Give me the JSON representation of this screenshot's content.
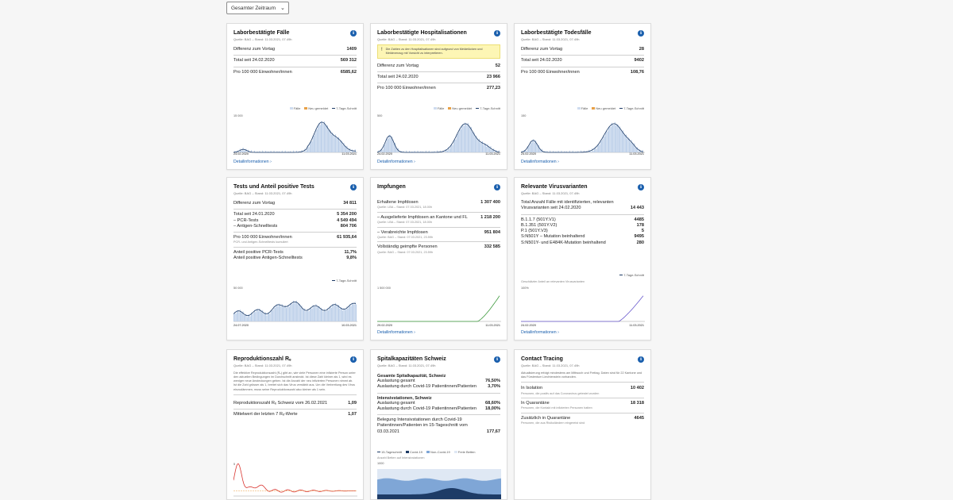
{
  "period_select": "Gesamter Zeitraum",
  "info_glyph": "i",
  "more_link": "Detailinformationen",
  "cards": {
    "faelle": {
      "title": "Laborbestätigte Fälle",
      "source": "Quelle: BAG – Stand: 11.03.2021, 07.49h",
      "rows": [
        {
          "label": "Differenz zum Vortag",
          "value": "1409"
        },
        {
          "label": "Total seit 24.02.2020",
          "value": "569 312"
        },
        {
          "label": "Pro 100 000 Einwohner/innen",
          "value": "6585,62"
        }
      ],
      "legend": [
        "Fälle",
        "Neu gemeldet",
        "7-Tage-Schnitt"
      ],
      "y_top": "15 000",
      "x_start": "24.02.2020",
      "x_end": "11.03.2021"
    },
    "hosp": {
      "title": "Laborbestätigte Hospitalisationen",
      "source": "Quelle: BAG – Stand: 11.03.2021, 07.49h",
      "notice": "Die Zahlen zu den Hospitalisationen sind aufgrund von Meldelücken und Meldeverzug mit Vorsicht zu interpretieren.",
      "rows": [
        {
          "label": "Differenz zum Vortag",
          "value": "52"
        },
        {
          "label": "Total seit 24.02.2020",
          "value": "23 966"
        },
        {
          "label": "Pro 100 000 Einwohner/innen",
          "value": "277,23"
        }
      ],
      "legend": [
        "Fälle",
        "Neu gemeldet",
        "7-Tage-Schnitt"
      ],
      "y_top": "500",
      "x_start": "24.02.2020",
      "x_end": "11.03.2021"
    },
    "tod": {
      "title": "Laborbestätigte Todesfälle",
      "source": "Quelle: BAG – Stand: 11.03.2021, 07.49h",
      "rows": [
        {
          "label": "Differenz zum Vortag",
          "value": "28"
        },
        {
          "label": "Total seit 24.02.2020",
          "value": "9402"
        },
        {
          "label": "Pro 100 000 Einwohner/innen",
          "value": "108,76"
        }
      ],
      "legend": [
        "Fälle",
        "Neu gemeldet",
        "7-Tage-Schnitt"
      ],
      "y_top": "150",
      "x_start": "24.02.2020",
      "x_end": "11.03.2021"
    },
    "tests": {
      "title": "Tests und Anteil positive Tests",
      "source": "Quelle: BAG – Stand: 11.03.2021, 07.49h",
      "diff_label": "Differenz zum Vortag",
      "diff_value": "34 811",
      "total_label": "Total seit 24.01.2020",
      "total_value": "5 354 200",
      "pcr_label": "PCR-Tests",
      "pcr_value": "4 549 494",
      "antigen_label": "Antigen-Schnelltests",
      "antigen_value": "804 706",
      "per100_label": "Pro 100 000 Einwohner/innen",
      "per100_value": "61 935,64",
      "per100_sub": "PCR- und Antigen-Schnelltests kumuliert",
      "pos_pcr_label": "Anteil positive PCR-Tests",
      "pos_pcr_value": "11,7%",
      "pos_ag_label": "Anteil positive Antigen-Schnelltests",
      "pos_ag_value": "9,8%",
      "legend": "7-Tage-Schnitt",
      "y_top": "50 000",
      "x_start": "24.07.2020",
      "x_end": "10.03.2021"
    },
    "impf": {
      "title": "Impfungen",
      "rows": [
        {
          "label": "Erhaltene Impfdosen",
          "sub": "Quelle: LBA – Stand: 07.03.2021, 18.00h",
          "value": "1 307 400"
        },
        {
          "label": "Ausgelieferte Impfdosen an Kantone und FL",
          "sub": "Quelle: LBA – Stand: 07.03.2021, 18.00h",
          "value": "1 218 200"
        },
        {
          "label": "Verabreichte Impfdosen",
          "sub": "Quelle: BAG – Stand: 07.03.2021, 23.59h",
          "value": "951 804"
        },
        {
          "label": "Vollständig geimpfte Personen",
          "sub": "Quelle: BAG – Stand: 07.03.2021, 23.59h",
          "value": "332 585"
        }
      ],
      "y_top": "1 500 000",
      "x_start": "29.02.2020",
      "x_end": "11.03.2021"
    },
    "varianten": {
      "title": "Relevante Virusvarianten",
      "source": "Quelle: BAG – Stand: 11.03.2021, 07.49h",
      "total_label": "Total Anzahl Fälle mit identifizierten, relevanten Virusvarianten seit 24.02.2020",
      "total_value": "14 443",
      "rows": [
        {
          "label": "B.1.1.7 (501Y.V1)",
          "value": "4485"
        },
        {
          "label": "B.1.351 (501Y.V2)",
          "value": "178"
        },
        {
          "label": "P.1 (501Y.V3)",
          "value": "5"
        },
        {
          "label": "S:N501Y – Mutation beinhaltend",
          "value": "9495"
        },
        {
          "label": "S:N501Y- und E484K-Mutation beinhaltend",
          "value": "280"
        }
      ],
      "legend": "7-Tage-Schnitt",
      "chart_caption": "Geschätzter Anteil an relevanten Virusvarianten",
      "y_top": "100%",
      "x_start": "24.02.2020",
      "x_end": "11.03.2021"
    },
    "re": {
      "title": "Reproduktionszahl Rₑ",
      "source": "Quelle: BAG – Stand: 11.03.2021, 07.49h",
      "desc": "Die effektive Reproduktionszahl (Rₑ) gibt an, wie viele Personen eine infizierte Person unter den aktuellen Bedingungen im Durchschnitt ansteckt. Ist diese Zahl kleiner als 1, wird es weniger neue Ansteckungen geben. Ist die Anzahl der neu infizierten Personen nimmt ab. Ist die Zahl grösser als 1, breitet sich das Virus verstärkt aus. Um die Verbreitung des Virus einzudämmen, muss seine Reproduktionszahl also kleiner als 1 sein.",
      "rows": [
        {
          "label": "Reproduktionszahl Rₑ Schweiz vom 26.02.2021",
          "value": "1,09"
        },
        {
          "label": "Mittelwert der letzten 7 Rₑ-Werte",
          "value": "1,07"
        }
      ],
      "y_top": "5"
    },
    "spital": {
      "title": "Spitalkapazitäten Schweiz",
      "source": "Quelle: BAG – Stand: 11.03.2021, 07.49h",
      "section1": "Gesamte Spitalkapazität, Schweiz",
      "rows1": [
        {
          "label": "Auslastung gesamt",
          "value": "76,50%"
        },
        {
          "label": "Auslastung durch Covid-19 Patientinnen/Patienten",
          "value": "3,70%"
        }
      ],
      "section2": "Intensivstationen, Schweiz",
      "rows2": [
        {
          "label": "Auslastung gesamt",
          "value": "68,60%"
        },
        {
          "label": "Auslastung durch Covid-19 Patientinnen/Patienten",
          "value": "18,00%"
        }
      ],
      "belegung_label": "Belegung Intensivstationen durch Covid-19 Patientinnen/Patienten im 15-Tageschnitt vom 03.03.2021",
      "belegung_value": "177,67",
      "legend": [
        "15-Tageschnitt",
        "Covid-19",
        "Non-Covid-19",
        "Freie Betten"
      ],
      "chart_caption": "Anzahl Betten auf Intensivstationen",
      "y_top": "1000"
    },
    "contact": {
      "title": "Contact Tracing",
      "source": "Quelle: BAG – Stand: 11.03.2021, 07.49h",
      "desc": "Aktualisierung erfolgt mindestens am Mittwoch und Freitag. Daten sind für 22 Kantone und das Fürstentum Liechtenstein vorhanden.",
      "rows": [
        {
          "label": "In Isolation",
          "sub": "Personen, die positiv auf das Coronavirus getestet wurden",
          "value": "10 402"
        },
        {
          "label": "In Quarantäne",
          "sub": "Personen, die Kontakt mit infizierten Personen hatten",
          "value": "18 318"
        },
        {
          "label": "Zusätzlich in Quarantäne",
          "sub": "Personen, die aus Risikoländern eingereist sind",
          "value": "4645"
        }
      ]
    }
  },
  "colors": {
    "accent": "#1a5fad",
    "bars": "#b9cde8",
    "line": "#1d3b66",
    "orange": "#e8a046",
    "green": "#3d9a3d",
    "red": "#d9332e"
  }
}
